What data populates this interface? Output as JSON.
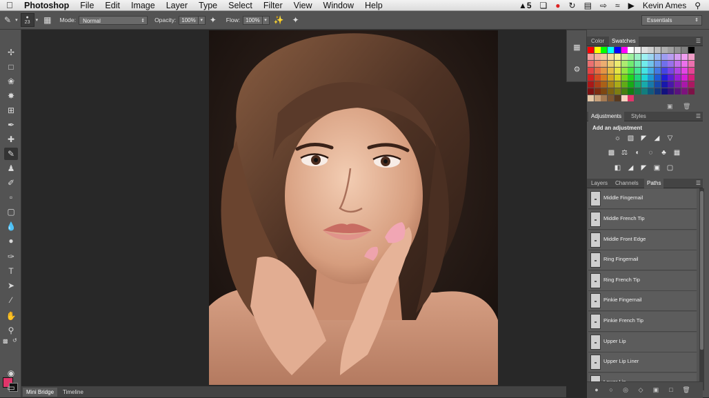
{
  "menubar": {
    "apple": "",
    "items": [
      "Photoshop",
      "File",
      "Edit",
      "Image",
      "Layer",
      "Type",
      "Select",
      "Filter",
      "View",
      "Window",
      "Help"
    ],
    "status": {
      "adobe_count": "5",
      "user": "Kevin Ames"
    }
  },
  "options": {
    "brush_size": "23",
    "mode_label": "Mode:",
    "mode_value": "Normal",
    "opacity_label": "Opacity:",
    "opacity_value": "100%",
    "flow_label": "Flow:",
    "flow_value": "100%",
    "workspace": "Essentials"
  },
  "colors": {
    "foreground": "#e0356a",
    "background": "#111111"
  },
  "bottom_tabs": [
    "Mini Bridge",
    "Timeline"
  ],
  "color_panel": {
    "tabs": [
      "Color",
      "Swatches"
    ],
    "active_tab": "Swatches"
  },
  "adjustments_panel": {
    "tabs": [
      "Adjustments",
      "Styles"
    ],
    "title": "Add an adjustment"
  },
  "paths_panel": {
    "tabs": [
      "Layers",
      "Channels",
      "Paths"
    ],
    "active_tab": "Paths",
    "items": [
      "Middle Fingernail",
      "Middle French Tip",
      "Middle Front Edge",
      "Ring Fingernail",
      "Ring French Tip",
      "Pinkie Fingernail",
      "Pinkie French Tip",
      "Upper Lip",
      "Upper Lip Liner",
      "Lower Lip"
    ]
  }
}
